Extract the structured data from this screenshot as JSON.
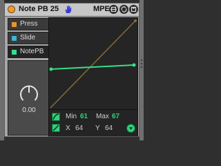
{
  "device": {
    "title": "Note PB 25",
    "mpe_label": "MPE",
    "accent_color": "#f19a2f",
    "curve_color": "#35e08a"
  },
  "destinations": [
    {
      "label": "Press",
      "color": "#e8962d"
    },
    {
      "label": "Slide",
      "color": "#3bb7d4"
    },
    {
      "label": "NotePB",
      "color": "#35e08a"
    }
  ],
  "knob": {
    "value": "0.00"
  },
  "range": {
    "min_label": "Min",
    "min_value": "61",
    "max_label": "Max",
    "max_value": "67"
  },
  "point": {
    "x_label": "X",
    "x_value": "64",
    "y_label": "Y",
    "y_value": "64"
  },
  "icons": {
    "hand": "hand-icon",
    "title_buttons": [
      "link-icon",
      "hot-swap-icon",
      "save-icon"
    ],
    "curve": "curve-icon",
    "point": "point-icon",
    "nav": "chevron-down-icon"
  }
}
